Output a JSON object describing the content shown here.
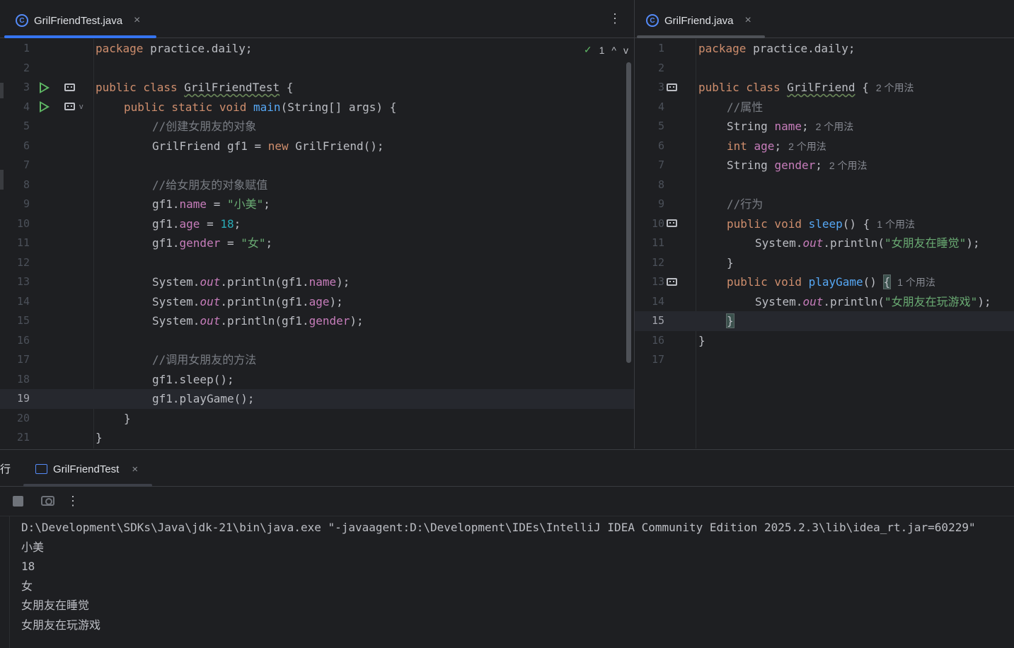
{
  "left_editor": {
    "tab": {
      "label": "GrilFriendTest.java",
      "close": "×"
    },
    "more_label": "⋮",
    "inspection": {
      "ok_mark": "✓",
      "count": "1",
      "up": "^",
      "down": "v"
    },
    "line_numbers": [
      "1",
      "2",
      "3",
      "4",
      "5",
      "6",
      "7",
      "8",
      "9",
      "10",
      "11",
      "12",
      "13",
      "14",
      "15",
      "16",
      "17",
      "18",
      "19",
      "20",
      "21"
    ],
    "current_line": "19",
    "code": {
      "l1_kw": "package",
      "l1_rest": " practice.daily;",
      "l3_kw": "public class ",
      "l3_cls": "GrilFriendTest",
      "l3_rest": " {",
      "l4_kw": "public static void ",
      "l4_fn": "main",
      "l4_rest": "(String[] args) {",
      "l5_cmt": "//创建女朋友的对象",
      "l6_a": "GrilFriend gf1 = ",
      "l6_kw": "new",
      "l6_b": " GrilFriend();",
      "l8_cmt": "//给女朋友的对象赋值",
      "l9_a": "gf1.",
      "l9_fld": "name",
      "l9_b": " = ",
      "l9_str": "\"小美\"",
      "l9_c": ";",
      "l10_a": "gf1.",
      "l10_fld": "age",
      "l10_b": " = ",
      "l10_num": "18",
      "l10_c": ";",
      "l11_a": "gf1.",
      "l11_fld": "gender",
      "l11_b": " = ",
      "l11_str": "\"女\"",
      "l11_c": ";",
      "l13_a": "System.",
      "l13_st": "out",
      "l13_b": ".println(gf1.",
      "l13_fld": "name",
      "l13_c": ");",
      "l14_a": "System.",
      "l14_st": "out",
      "l14_b": ".println(gf1.",
      "l14_fld": "age",
      "l14_c": ");",
      "l15_a": "System.",
      "l15_st": "out",
      "l15_b": ".println(gf1.",
      "l15_fld": "gender",
      "l15_c": ");",
      "l17_cmt": "//调用女朋友的方法",
      "l18": "gf1.sleep();",
      "l19": "gf1.playGame();",
      "l20": "}",
      "l21": "}"
    }
  },
  "right_editor": {
    "tab": {
      "label": "GrilFriend.java",
      "close": "×"
    },
    "line_numbers": [
      "1",
      "2",
      "3",
      "4",
      "5",
      "6",
      "7",
      "8",
      "9",
      "10",
      "11",
      "12",
      "13",
      "14",
      "15",
      "16",
      "17"
    ],
    "current_line": "15",
    "code": {
      "l1_kw": "package",
      "l1_rest": " practice.daily;",
      "l3_kw": "public class ",
      "l3_cls": "GrilFriend",
      "l3_rest": " {",
      "l3_hint": "2 个用法",
      "l4_cmt": "//属性",
      "l5_a": "String ",
      "l5_fld": "name",
      "l5_b": ";",
      "l5_hint": "2 个用法",
      "l6_kw": "int ",
      "l6_fld": "age",
      "l6_b": ";",
      "l6_hint": "2 个用法",
      "l7_a": "String ",
      "l7_fld": "gender",
      "l7_b": ";",
      "l7_hint": "2 个用法",
      "l9_cmt": "//行为",
      "l10_kw": "public void ",
      "l10_fn": "sleep",
      "l10_rest": "() {",
      "l10_hint": "1 个用法",
      "l11_a": "System.",
      "l11_st": "out",
      "l11_b": ".println(",
      "l11_str": "\"女朋友在睡觉\"",
      "l11_c": ");",
      "l12": "}",
      "l13_kw": "public void ",
      "l13_fn": "playGame",
      "l13_rest": "() ",
      "l13_brace": "{",
      "l13_hint": "1 个用法",
      "l14_a": "System.",
      "l14_st": "out",
      "l14_b": ".println(",
      "l14_str": "\"女朋友在玩游戏\"",
      "l14_c": ");",
      "l15_brace": "}",
      "l16": "}"
    }
  },
  "run_panel": {
    "title": "行",
    "tab": {
      "label": "GrilFriendTest",
      "close": "×"
    },
    "more_label": "⋮",
    "output": [
      "D:\\Development\\SDKs\\Java\\jdk-21\\bin\\java.exe \"-javaagent:D:\\Development\\IDEs\\IntelliJ IDEA Community Edition 2025.2.3\\lib\\idea_rt.jar=60229\"",
      "小美",
      "18",
      "女",
      "女朋友在睡觉",
      "女朋友在玩游戏"
    ]
  },
  "colors": {
    "keyword": "#cf8e6d",
    "method": "#56a8f5",
    "field": "#c77dbb",
    "string": "#6aab73",
    "number": "#2aacb8",
    "comment": "#7a7e85",
    "accent": "#548af7",
    "run": "#5fb865"
  }
}
